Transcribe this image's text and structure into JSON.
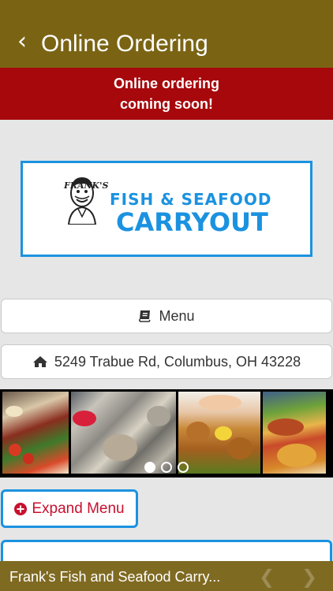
{
  "header": {
    "back_icon": "chevron-left-icon",
    "title": "Online Ordering"
  },
  "banner": {
    "line1": "Online ordering",
    "line2": "coming soon!"
  },
  "logo": {
    "small_text": "FRANK'S",
    "line1": "FISH & SEAFOOD",
    "line2": "CARRYOUT",
    "accent_color": "#1b92e0"
  },
  "buttons": {
    "menu_label": "Menu",
    "menu_icon": "book-icon",
    "address_label": "5249 Trabue Rd, Columbus, OH 43228",
    "address_icon": "home-icon"
  },
  "carousel": {
    "photos": [
      "food-photo",
      "food-photo",
      "food-photo",
      "food-photo"
    ],
    "page_count": 3,
    "active_page": 1
  },
  "expand_menu": {
    "label": "Expand Menu",
    "icon": "plus-circle-icon",
    "icon_color": "#c8102e"
  },
  "footer": {
    "title": "Frank's Fish and Seafood Carry...",
    "prev_icon": "chevron-left-icon",
    "next_icon": "chevron-right-icon"
  },
  "colors": {
    "header_bg": "#7a6414",
    "banner_bg": "#a7080c",
    "page_bg": "#e6e6e6"
  }
}
